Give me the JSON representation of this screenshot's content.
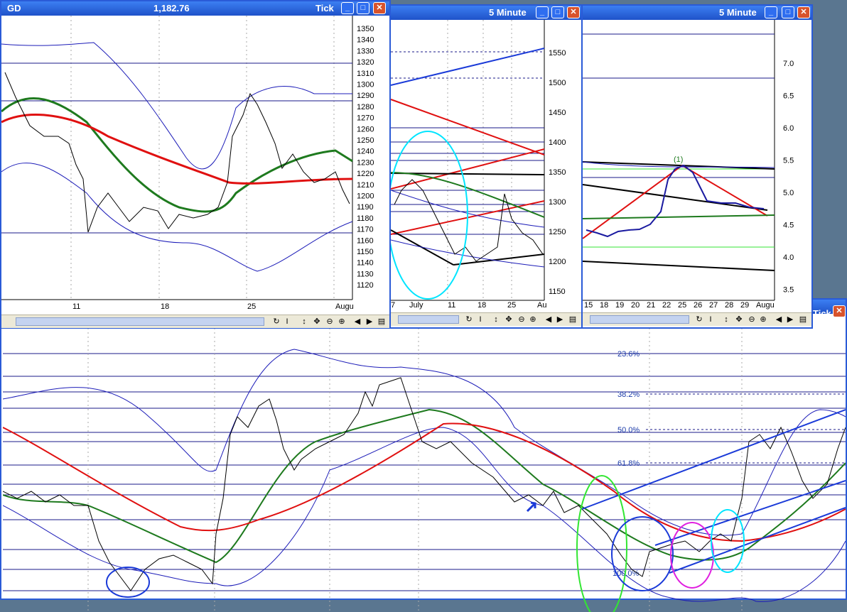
{
  "window1": {
    "symbol": "GD",
    "price": "1,182.76",
    "interval": "Tick",
    "y_labels": [
      "1350",
      "1340",
      "1330",
      "1320",
      "1310",
      "1300",
      "1290",
      "1280",
      "1270",
      "1260",
      "1250",
      "1240",
      "1230",
      "1220",
      "1210",
      "1200",
      "1190",
      "1180",
      "1170",
      "1160",
      "1150",
      "1140",
      "1130",
      "1120"
    ],
    "x_labels": [
      "11",
      "18",
      "25",
      "Augu"
    ]
  },
  "window2": {
    "interval": "5 Minute",
    "y_labels": [
      "1550",
      "1500",
      "1450",
      "1400",
      "1350",
      "1300",
      "1250",
      "1200",
      "1150"
    ],
    "x_labels": [
      "7",
      "July",
      "11",
      "18",
      "25",
      "Au"
    ]
  },
  "window3": {
    "interval": "5 Minute",
    "wave_label": "(1)",
    "y_labels": [
      "7.0",
      "6.5",
      "6.0",
      "5.5",
      "5.0",
      "4.5",
      "4.0",
      "3.5"
    ],
    "x_labels": [
      "15",
      "18",
      "19",
      "20",
      "21",
      "22",
      "25",
      "26",
      "27",
      "28",
      "29",
      "Augu"
    ]
  },
  "window4": {
    "interval": "Tick",
    "fib_labels": [
      "23.6%",
      "38.2%",
      "50.0%",
      "61.8%",
      "100.0%"
    ]
  },
  "colors": {
    "title_bar": "#2a5bd7",
    "price": "#000000",
    "ma_green": "#1e7a1e",
    "ma_red": "#e01010",
    "bands": "#1c1cb8",
    "cyan": "#00e5ff",
    "lime": "#33e633",
    "magenta": "#e020e0"
  }
}
